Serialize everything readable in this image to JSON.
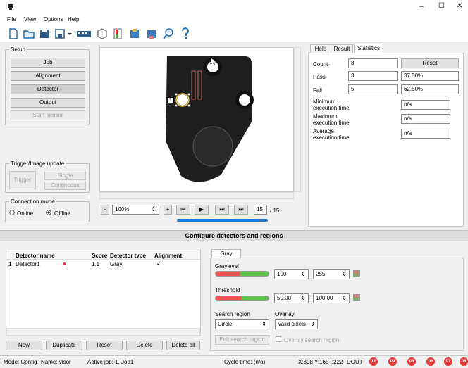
{
  "window": {
    "minimize_glyph": "–",
    "maximize_glyph": "☐",
    "close_glyph": "✕"
  },
  "menu": [
    "File",
    "View",
    "Options",
    "Help"
  ],
  "setup": {
    "title": "Setup",
    "job": "Job",
    "alignment": "Alignment",
    "detector": "Detector",
    "output": "Output",
    "start_sensor": "Start sensor"
  },
  "trigger": {
    "title": "Trigger/Image update",
    "trigger": "Trigger",
    "single": "Single",
    "continuous": "Continuous"
  },
  "connection": {
    "title": "Connection mode",
    "online": "Online",
    "offline": "Offline"
  },
  "viewer": {
    "zoom_minus": "-",
    "zoom": "100%",
    "zoom_plus": "+",
    "frame": "15",
    "frame_total": "/ 15",
    "marker": "1"
  },
  "right_tabs": [
    "Help",
    "Result",
    "Statistics"
  ],
  "stats": {
    "count_label": "Count",
    "count": "8",
    "reset": "Reset",
    "pass_label": "Pass",
    "pass": "3",
    "pass_pct": "37.50%",
    "fail_label": "Fail",
    "fail": "5",
    "fail_pct": "62.50%",
    "min_label": "Minimum execution time",
    "min": "n/a",
    "max_label": "Maximum execution time",
    "max": "n/a",
    "avg_label": "Average execution time",
    "avg": "n/a"
  },
  "configure_title": "Configure detectors and regions",
  "table": {
    "headers": [
      "Detector name",
      "Score",
      "Detector type",
      "Alignment"
    ],
    "rows": [
      {
        "idx": "1",
        "name": "Detector1",
        "score": "1.1",
        "type": "Gray",
        "alignment": "✓"
      }
    ]
  },
  "table_buttons": {
    "new": "New",
    "duplicate": "Duplicate",
    "reset": "Reset",
    "delete": "Delete",
    "delete_all": "Delete all"
  },
  "gray": {
    "tab": "Gray",
    "graylevel_label": "Graylevel",
    "gl_min": "100",
    "gl_max": "255",
    "threshold_label": "Threshold",
    "th_min": "50,00",
    "th_max": "100,00",
    "search_region_label": "Search region",
    "overlay_label": "Overlay",
    "search_region": "Circle",
    "overlay": "Valid pixels",
    "edit_region": "Edit search region",
    "overlay_region": "Overlay search region"
  },
  "status": {
    "mode": "Mode: Config",
    "name": "Name: visor",
    "job": "Active job: 1, Job1",
    "cycle": "Cycle time: (n/a)",
    "coords": "X:398 Y:165 I:222",
    "dout": "DOUT",
    "leds": [
      "12",
      "09",
      "05",
      "06",
      "07",
      "08"
    ]
  },
  "colors": {
    "accent": "#1e78d7",
    "red_led": "#e53935",
    "slider_green": "#5ec24c",
    "slider_red": "#ef5350"
  }
}
